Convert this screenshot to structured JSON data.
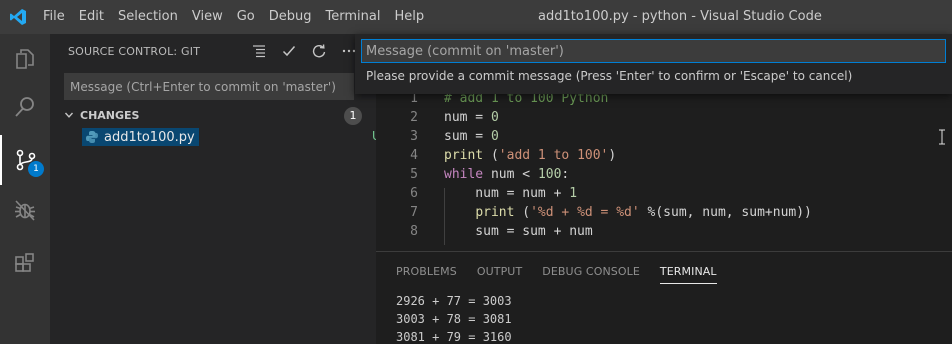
{
  "titlebar": {
    "menu": [
      "File",
      "Edit",
      "Selection",
      "View",
      "Go",
      "Debug",
      "Terminal",
      "Help"
    ],
    "title": "add1to100.py - python - Visual Studio Code"
  },
  "activitybar": {
    "items": [
      "files-icon",
      "search-icon",
      "source-control-icon",
      "debug-icon",
      "extensions-icon"
    ],
    "scm_badge": "1"
  },
  "sidebar": {
    "header": "SOURCE CONTROL: GIT",
    "commit_placeholder": "Message (Ctrl+Enter to commit on 'master')",
    "changes_label": "CHANGES",
    "changes_count": "1",
    "file": {
      "name": "add1to100.py",
      "status": "U"
    }
  },
  "editor": {
    "lines": [
      {
        "n": "1",
        "tokens": [
          [
            "com",
            "# add 1 to 100 Python"
          ]
        ]
      },
      {
        "n": "2",
        "tokens": [
          [
            "",
            "num = "
          ],
          [
            "num",
            "0"
          ]
        ]
      },
      {
        "n": "3",
        "tokens": [
          [
            "",
            "sum = "
          ],
          [
            "num",
            "0"
          ]
        ]
      },
      {
        "n": "4",
        "tokens": [
          [
            "fn",
            "print"
          ],
          [
            "",
            " ("
          ],
          [
            "str",
            "'add 1 to 100'"
          ],
          [
            "",
            ")"
          ]
        ]
      },
      {
        "n": "5",
        "tokens": [
          [
            "kw",
            "while"
          ],
          [
            "",
            " num < "
          ],
          [
            "num",
            "100"
          ],
          [
            "",
            ":"
          ]
        ]
      },
      {
        "n": "6",
        "tokens": [
          [
            "",
            "    num = num + "
          ],
          [
            "num",
            "1"
          ]
        ]
      },
      {
        "n": "7",
        "tokens": [
          [
            "",
            "    "
          ],
          [
            "fn",
            "print"
          ],
          [
            "",
            " ("
          ],
          [
            "str",
            "'%d + %d = %d'"
          ],
          [
            "",
            " %(sum, num, sum+num))"
          ]
        ]
      },
      {
        "n": "8",
        "tokens": [
          [
            "",
            "    sum = sum + num"
          ]
        ]
      }
    ]
  },
  "panel": {
    "tabs": [
      "PROBLEMS",
      "OUTPUT",
      "DEBUG CONSOLE",
      "TERMINAL"
    ],
    "active_tab": "TERMINAL",
    "terminal_lines": [
      "2926 + 77 = 3003",
      "3003 + 78 = 3081",
      "3081 + 79 = 3160"
    ]
  },
  "quick_input": {
    "placeholder": "Message (commit on 'master')",
    "message": "Please provide a commit message (Press 'Enter' to confirm or 'Escape' to cancel)"
  },
  "colors": {
    "accent": "#007acc",
    "selection": "#094771",
    "untracked": "#73c991"
  }
}
